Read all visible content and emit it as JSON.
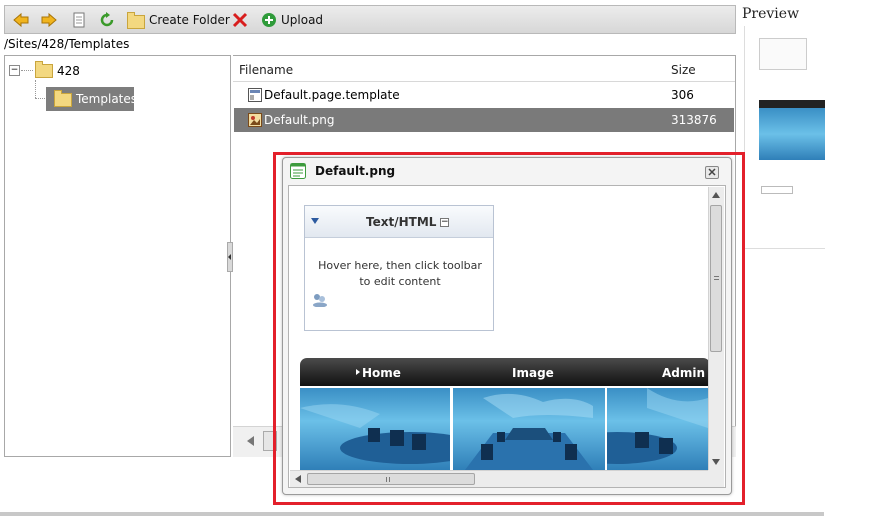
{
  "toolbar": {
    "create_folder_label": "Create Folder",
    "upload_label": "Upload"
  },
  "path": "/Sites/428/Templates",
  "tree": {
    "root_label": "428",
    "child_label": "Templates"
  },
  "file_list": {
    "columns": [
      "Filename",
      "Size"
    ],
    "rows": [
      {
        "name": "Default.page.template",
        "size": "306"
      },
      {
        "name": "Default.png",
        "size": "313876"
      }
    ]
  },
  "preview": {
    "title": "Preview"
  },
  "popup": {
    "title": "Default.png",
    "module": {
      "title": "Text/HTML",
      "body": "Hover here, then click toolbar to edit content"
    },
    "nav": [
      "Home",
      "Image",
      "Admin"
    ]
  },
  "colors": {
    "highlight": "#e3202b",
    "selected_row": "#7a7a7a",
    "nav_bar": "#1e1e1e"
  }
}
